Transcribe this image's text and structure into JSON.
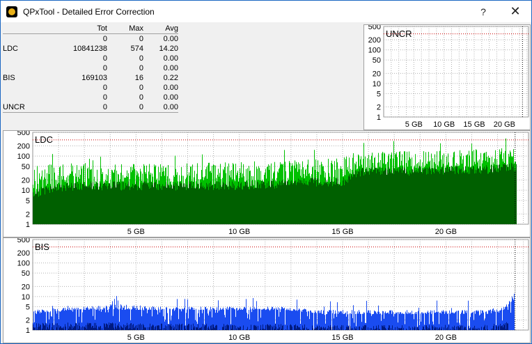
{
  "window": {
    "title": "QPxTool - Detailed Error Correction",
    "help_label": "?",
    "close_label": "✕"
  },
  "stats": {
    "headers": [
      "",
      "Tot",
      "Max",
      "Avg"
    ],
    "rows": [
      [
        "",
        "0",
        "0",
        "0.00"
      ],
      [
        "LDC",
        "10841238",
        "574",
        "14.20"
      ],
      [
        "",
        "0",
        "0",
        "0.00"
      ],
      [
        "",
        "0",
        "0",
        "0.00"
      ],
      [
        "BIS",
        "169103",
        "16",
        "0.22"
      ],
      [
        "",
        "0",
        "0",
        "0.00"
      ],
      [
        "",
        "0",
        "0",
        "0.00"
      ],
      [
        "UNCR",
        "0",
        "0",
        "0.00"
      ]
    ]
  },
  "chart_data": [
    {
      "type": "bar",
      "title": "UNCR",
      "y_scale": "log",
      "ylim": [
        1,
        500
      ],
      "yticks": [
        "500",
        "200",
        "100",
        "50",
        "20",
        "10",
        "5",
        "2",
        "1"
      ],
      "xticks": [
        "5 GB",
        "10 GB",
        "15 GB",
        "20 GB"
      ],
      "xlim_gb": [
        0,
        24
      ],
      "series": [
        {
          "values": []
        }
      ],
      "colors": {
        "plot": "#ffffff",
        "grid": "#b0b0b0",
        "limit": "#cc0000"
      }
    },
    {
      "type": "bar",
      "title": "LDC",
      "y_scale": "log",
      "ylim": [
        1,
        500
      ],
      "yticks": [
        "500",
        "200",
        "100",
        "50",
        "20",
        "10",
        "5",
        "2",
        "1"
      ],
      "xticks": [
        "5 GB",
        "10 GB",
        "15 GB",
        "20 GB"
      ],
      "xlim_gb": [
        0,
        24
      ],
      "series": [
        {
          "x": [
            0,
            1,
            2,
            3,
            4,
            5,
            6,
            7,
            8,
            9,
            10,
            11,
            12,
            13,
            14,
            15,
            16,
            17,
            18,
            19,
            20,
            21,
            22,
            23,
            23.4
          ],
          "peak": [
            50,
            60,
            65,
            60,
            60,
            60,
            60,
            60,
            65,
            65,
            70,
            70,
            75,
            80,
            85,
            100,
            130,
            140,
            140,
            140,
            150,
            160,
            170,
            180,
            180
          ],
          "avg": [
            10,
            15,
            18,
            18,
            18,
            18,
            18,
            18,
            18,
            18,
            18,
            20,
            22,
            24,
            24,
            24,
            45,
            45,
            45,
            45,
            48,
            48,
            50,
            60,
            60
          ],
          "color": "#00c000"
        },
        {
          "x": [
            0,
            1,
            2,
            3,
            4,
            5,
            6,
            7,
            8,
            9,
            10,
            11,
            12,
            13,
            14,
            15,
            16,
            17,
            18,
            19,
            20,
            21,
            22,
            23,
            23.4
          ],
          "values": [
            8,
            12,
            14,
            14,
            14,
            14,
            14,
            14,
            14,
            14,
            14,
            15,
            16,
            18,
            18,
            18,
            38,
            38,
            38,
            38,
            40,
            40,
            42,
            50,
            50
          ],
          "color": "#006000"
        }
      ],
      "colors": {
        "plot": "#ffffff",
        "grid": "#b0b0b0",
        "limit": "#cc0000"
      }
    },
    {
      "type": "bar",
      "title": "BIS",
      "y_scale": "log",
      "ylim": [
        1,
        500
      ],
      "yticks": [
        "500",
        "200",
        "100",
        "50",
        "20",
        "10",
        "5",
        "2",
        "1"
      ],
      "xticks": [
        "5 GB",
        "10 GB",
        "15 GB",
        "20 GB"
      ],
      "xlim_gb": [
        0,
        24
      ],
      "series": [
        {
          "x": [
            0,
            2,
            4,
            6,
            8,
            10,
            12,
            14,
            16,
            18,
            20,
            22,
            23,
            23.3
          ],
          "peak": [
            4,
            5,
            6,
            5,
            5,
            5,
            5,
            4,
            4,
            4,
            4,
            4,
            6,
            15
          ],
          "avg": [
            3,
            4,
            4,
            4,
            4,
            4,
            4,
            3,
            3,
            3,
            3,
            3,
            4,
            10
          ],
          "color": "#1a4cf0"
        },
        {
          "x": [
            0,
            2,
            4,
            6,
            8,
            10,
            12,
            14,
            16,
            18,
            20,
            22,
            23
          ],
          "values": [
            1.3,
            1.3,
            1.3,
            1.2,
            1.2,
            1.2,
            1.2,
            1.1,
            1.1,
            1.1,
            1.1,
            1.1,
            1.4
          ],
          "color": "#001a80"
        }
      ],
      "colors": {
        "plot": "#ffffff",
        "grid": "#b0b0b0",
        "limit": "#cc0000"
      }
    }
  ]
}
